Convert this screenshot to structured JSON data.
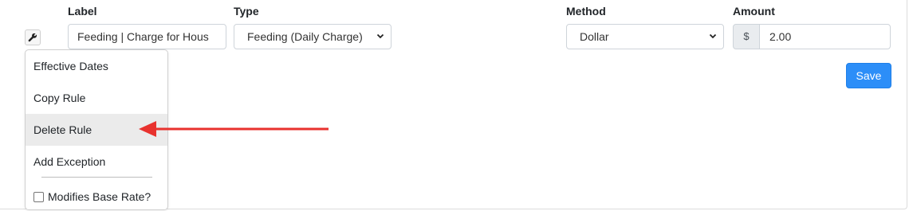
{
  "form": {
    "label_header": "Label",
    "type_header": "Type",
    "method_header": "Method",
    "amount_header": "Amount",
    "label_value": "Feeding | Charge for Hous",
    "type_value": "Feeding (Daily Charge)",
    "method_value": "Dollar",
    "amount_prefix": "$",
    "amount_value": "2.00",
    "save_label": "Save"
  },
  "menu": {
    "items": [
      {
        "label": "Effective Dates"
      },
      {
        "label": "Copy Rule"
      },
      {
        "label": "Delete Rule",
        "highlighted": true
      },
      {
        "label": "Add Exception"
      }
    ],
    "checkbox_label": "Modifies Base Rate?",
    "checkbox_checked": false
  },
  "annotation": {
    "arrow_color": "#e8322e",
    "arrow_target": "Delete Rule"
  },
  "colors": {
    "save_button": "#2c8ef8",
    "menu_highlight": "#ebebeb"
  }
}
